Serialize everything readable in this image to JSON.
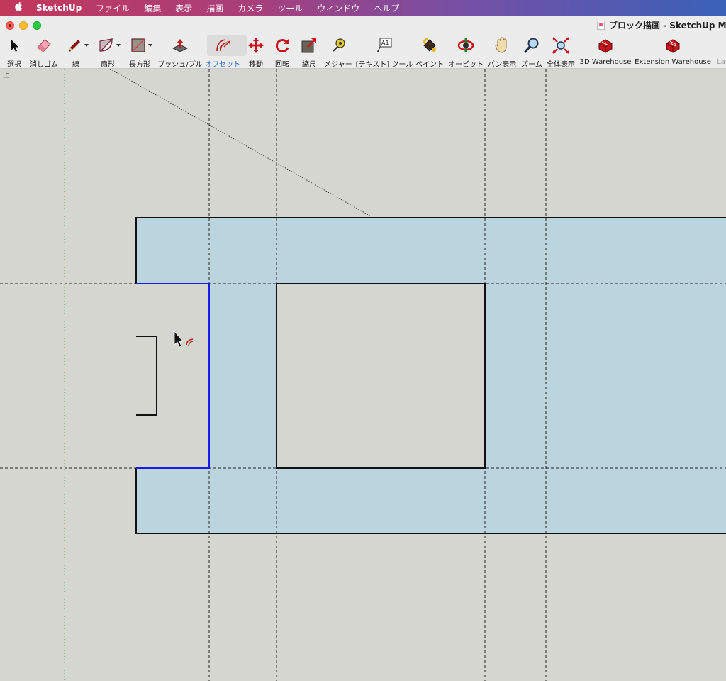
{
  "menubar": {
    "apple": "",
    "app_name": "SketchUp",
    "items": [
      "ファイル",
      "編集",
      "表示",
      "描画",
      "カメラ",
      "ツール",
      "ウィンドウ",
      "ヘルプ"
    ]
  },
  "window": {
    "title": "ブロック描画 - SketchUp Mak"
  },
  "toolbar": {
    "tools": [
      {
        "label": "選択",
        "icon": "select-arrow-icon"
      },
      {
        "label": "消しゴム",
        "icon": "eraser-icon"
      },
      {
        "label": "線",
        "icon": "pencil-icon"
      },
      {
        "label": "扇形",
        "icon": "arc-icon"
      },
      {
        "label": "長方形",
        "icon": "rectangle-icon"
      },
      {
        "label": "プッシュ/プル",
        "icon": "push-pull-icon"
      },
      {
        "label": "オフセット",
        "icon": "offset-icon"
      },
      {
        "label": "移動",
        "icon": "move-icon"
      },
      {
        "label": "回転",
        "icon": "rotate-icon"
      },
      {
        "label": "縮尺",
        "icon": "scale-icon"
      },
      {
        "label": "メジャー",
        "icon": "tape-measure-icon"
      },
      {
        "label": "[テキスト] ツール",
        "icon": "text-tool-icon"
      },
      {
        "label": "ペイント",
        "icon": "paint-bucket-icon"
      },
      {
        "label": "オービット",
        "icon": "orbit-icon"
      },
      {
        "label": "パン表示",
        "icon": "pan-hand-icon"
      },
      {
        "label": "ズーム",
        "icon": "zoom-magnifier-icon"
      },
      {
        "label": "全体表示",
        "icon": "zoom-extents-icon"
      },
      {
        "label": "3D Warehouse",
        "icon": "3d-warehouse-icon"
      },
      {
        "label": "Extension Warehouse",
        "icon": "extension-warehouse-icon"
      },
      {
        "label": "Lay",
        "icon": ""
      }
    ],
    "active_tool": "オフセット",
    "text_tool_badge": "A1"
  },
  "viewport": {
    "view_label": "上",
    "face_color": "#bcd4de",
    "background_color": "#d6d6d0",
    "selected_edge_color": "#1a1af0"
  }
}
